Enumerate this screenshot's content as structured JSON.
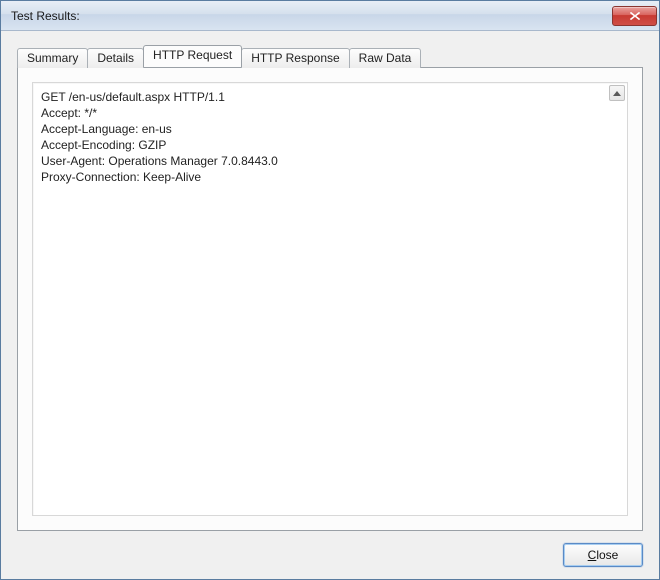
{
  "window": {
    "title": "Test Results:"
  },
  "tabs": {
    "summary": "Summary",
    "details": "Details",
    "http_request": "HTTP Request",
    "http_response": "HTTP Response",
    "raw_data": "Raw Data",
    "active": "http_request"
  },
  "request": {
    "lines": [
      "GET /en-us/default.aspx HTTP/1.1",
      "Accept: */*",
      "Accept-Language: en-us",
      "Accept-Encoding: GZIP",
      "User-Agent: Operations Manager 7.0.8443.0",
      "Proxy-Connection: Keep-Alive"
    ]
  },
  "buttons": {
    "close": "Close"
  }
}
